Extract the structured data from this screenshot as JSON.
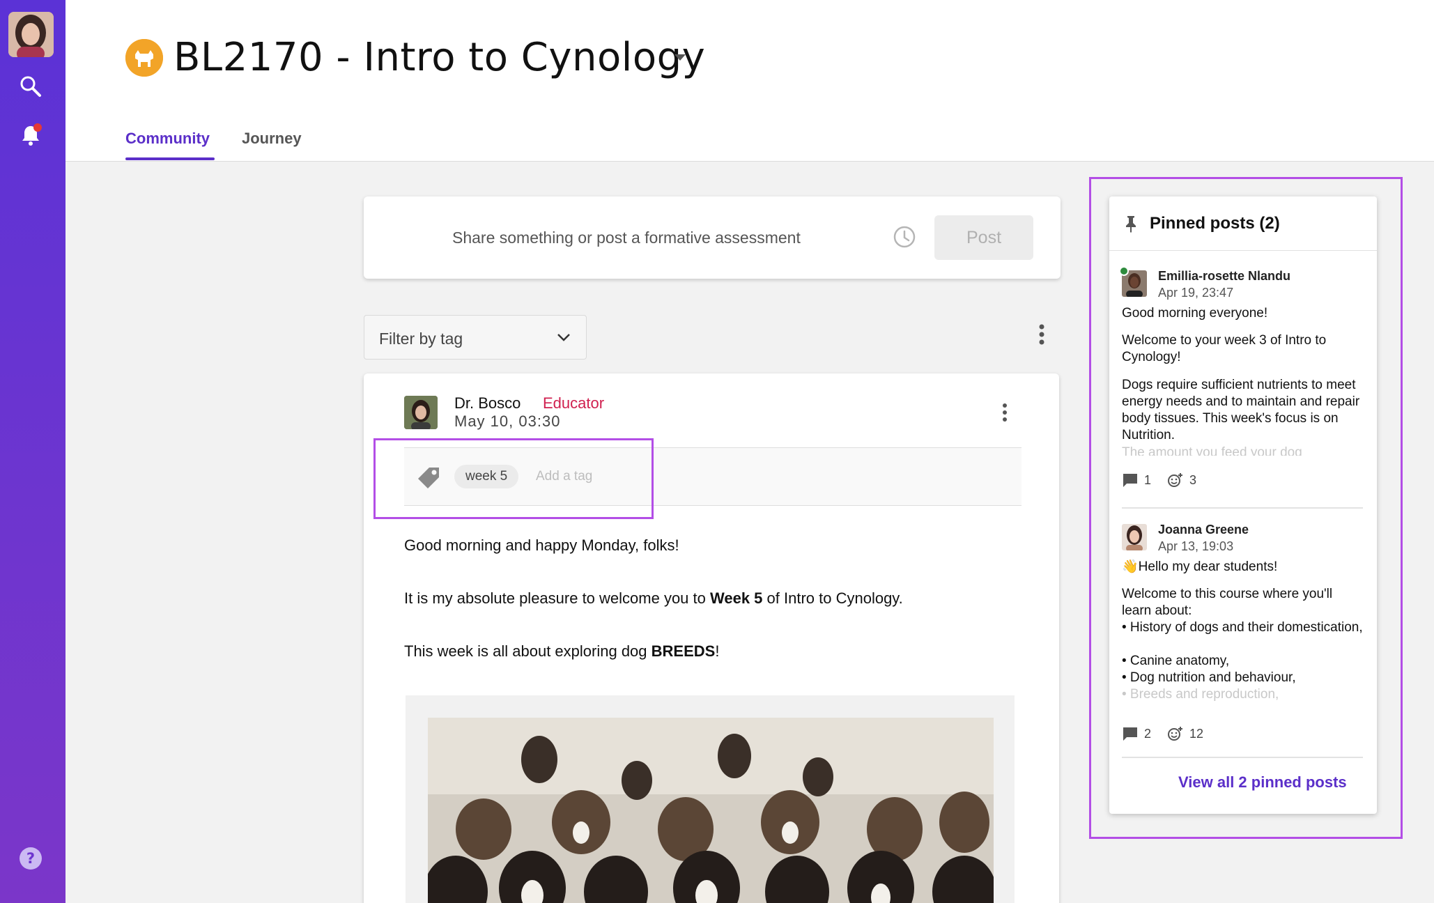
{
  "sidebar": {
    "icons": [
      "avatar",
      "search-icon",
      "bell-icon",
      "help-icon"
    ],
    "notification_dot_color": "#e53935"
  },
  "course": {
    "title": "BL2170 - Intro to Cynology",
    "logo_color": "#f2a428"
  },
  "tabs": [
    {
      "label": "Community",
      "active": true
    },
    {
      "label": "Journey",
      "active": false
    }
  ],
  "composer": {
    "placeholder": "Share something or post a formative assessment",
    "post_label": "Post"
  },
  "filter": {
    "label": "Filter by tag"
  },
  "post": {
    "author": "Dr. Bosco",
    "role": "Educator",
    "date": "May 10, 03:30",
    "tags": [
      "week 5"
    ],
    "add_tag_placeholder": "Add a tag",
    "para1": "Good morning and happy Monday, folks!",
    "para2_pre": "It is my absolute pleasure to welcome you to ",
    "para2_bold": "Week 5",
    "para2_post": " of Intro to Cynology.",
    "para3_pre": "This week is all about exploring dog ",
    "para3_bold": "BREEDS",
    "para3_post": "!"
  },
  "pinned": {
    "title": "Pinned posts (2)",
    "posts": [
      {
        "author": "Emillia-rosette Nlandu",
        "date": "Apr 19, 23:47",
        "online": true,
        "lines": [
          "Good morning everyone!",
          "Welcome to your week 3 of Intro to Cynology!",
          "Dogs require sufficient nutrients to meet energy needs and to maintain and repair body tissues. This week's focus is on Nutrition.",
          "The amount you feed your dog"
        ],
        "comments": "1",
        "reactions": "3"
      },
      {
        "author": "Joanna Greene",
        "date": "Apr 13, 19:03",
        "online": false,
        "lines": [
          "👋Hello my dear students!",
          "Welcome to this course where you'll learn about:",
          "• History of dogs and their domestication,",
          "• Canine anatomy,",
          "• Dog nutrition and behaviour,",
          "• Breeds and reproduction,"
        ],
        "comments": "2",
        "reactions": "12"
      }
    ],
    "view_all_label": "View all 2 pinned posts"
  },
  "colors": {
    "accent": "#5b2fc9",
    "educator": "#d0204f",
    "highlight": "#b34ee6"
  }
}
